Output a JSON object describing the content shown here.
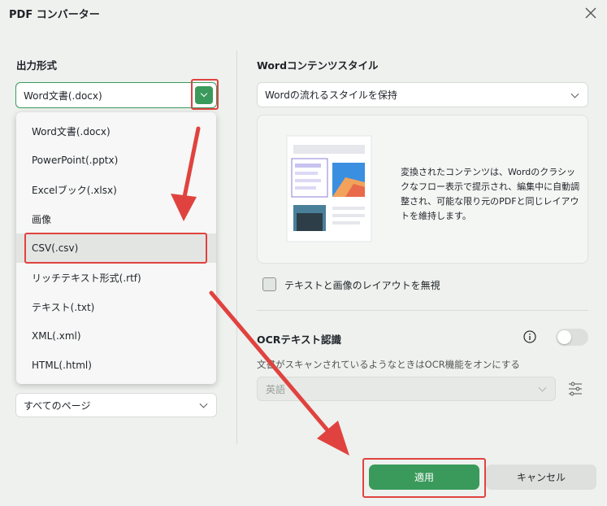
{
  "window": {
    "title": "PDF コンバーター"
  },
  "left": {
    "output_format_label": "出力形式",
    "format_select_value": "Word文書(.docx)",
    "format_options": [
      "Word文書(.docx)",
      "PowerPoint(.pptx)",
      "Excelブック(.xlsx)",
      "画像",
      "CSV(.csv)",
      "リッチテキスト形式(.rtf)",
      "テキスト(.txt)",
      "XML(.xml)",
      "HTML(.html)"
    ],
    "selected_option_index": 4,
    "page_range_value": "すべてのページ"
  },
  "right": {
    "style_label": "Wordコンテンツスタイル",
    "style_select_value": "Wordの流れるスタイルを保持",
    "style_description": "変換されたコンテンツは、Wordのクラシックなフロー表示で提示され、編集中に自動調整され、可能な限り元のPDFと同じレイアウトを維持します。",
    "ignore_layout_label": "テキストと画像のレイアウトを無視",
    "ignore_layout_checked": false,
    "ocr_label": "OCRテキスト認識",
    "ocr_enabled": false,
    "ocr_description": "文書がスキャンされているようなときはOCR機能をオンにする",
    "ocr_language_value": "英語"
  },
  "footer": {
    "apply_label": "適用",
    "cancel_label": "キャンセル"
  },
  "colors": {
    "accent": "#3a9a5b",
    "annotation": "#e0433f",
    "background": "#eef1ee"
  },
  "icons": [
    "close-icon",
    "chevron-down-icon",
    "info-icon",
    "settings-sliders-icon"
  ]
}
